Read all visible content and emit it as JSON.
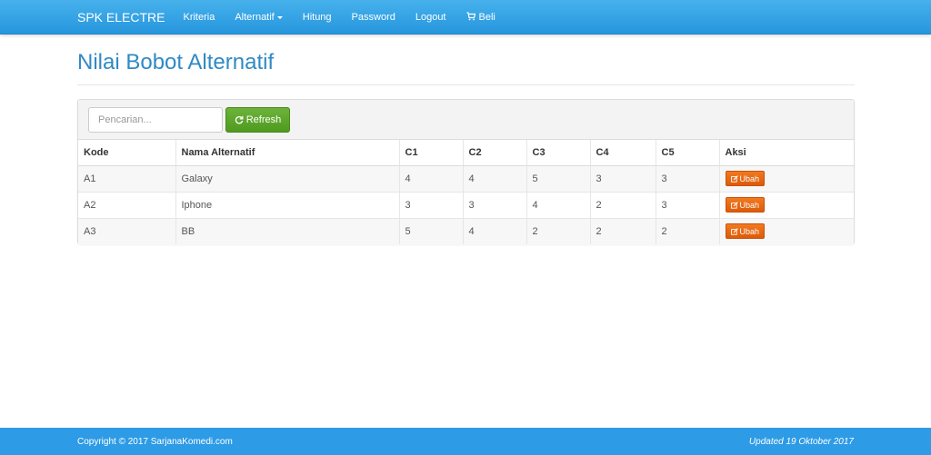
{
  "navbar": {
    "brand": "SPK ELECTRE",
    "items": [
      {
        "label": "Kriteria"
      },
      {
        "label": "Alternatif"
      },
      {
        "label": "Hitung"
      },
      {
        "label": "Password"
      },
      {
        "label": "Logout"
      },
      {
        "label": "Beli",
        "icon": "cart-icon"
      }
    ]
  },
  "page": {
    "title": "Nilai Bobot Alternatif"
  },
  "toolbar": {
    "search_placeholder": "Pencarian...",
    "search_value": "",
    "refresh_label": "Refresh",
    "refresh_icon": "refresh-icon",
    "refresh_color": "#5ba72b"
  },
  "table": {
    "headers": [
      "Kode",
      "Nama Alternatif",
      "C1",
      "C2",
      "C3",
      "C4",
      "C5",
      "Aksi"
    ],
    "rows": [
      {
        "kode": "A1",
        "nama": "Galaxy",
        "c1": "4",
        "c2": "4",
        "c3": "5",
        "c4": "3",
        "c5": "3",
        "aksi": "Ubah"
      },
      {
        "kode": "A2",
        "nama": "Iphone",
        "c1": "3",
        "c2": "3",
        "c3": "4",
        "c4": "2",
        "c5": "3",
        "aksi": "Ubah"
      },
      {
        "kode": "A3",
        "nama": "BB",
        "c1": "5",
        "c2": "4",
        "c3": "2",
        "c4": "2",
        "c5": "2",
        "aksi": "Ubah"
      }
    ],
    "action_icon": "edit-icon",
    "action_color": "#e8650f"
  },
  "footer": {
    "copyright": "Copyright © 2017 SarjanaKomedi.com",
    "updated": "Updated 19 Oktober 2017"
  },
  "colors": {
    "navbar": "#2b9de6",
    "title": "#2f8ac4",
    "footer": "#2d9be6"
  }
}
